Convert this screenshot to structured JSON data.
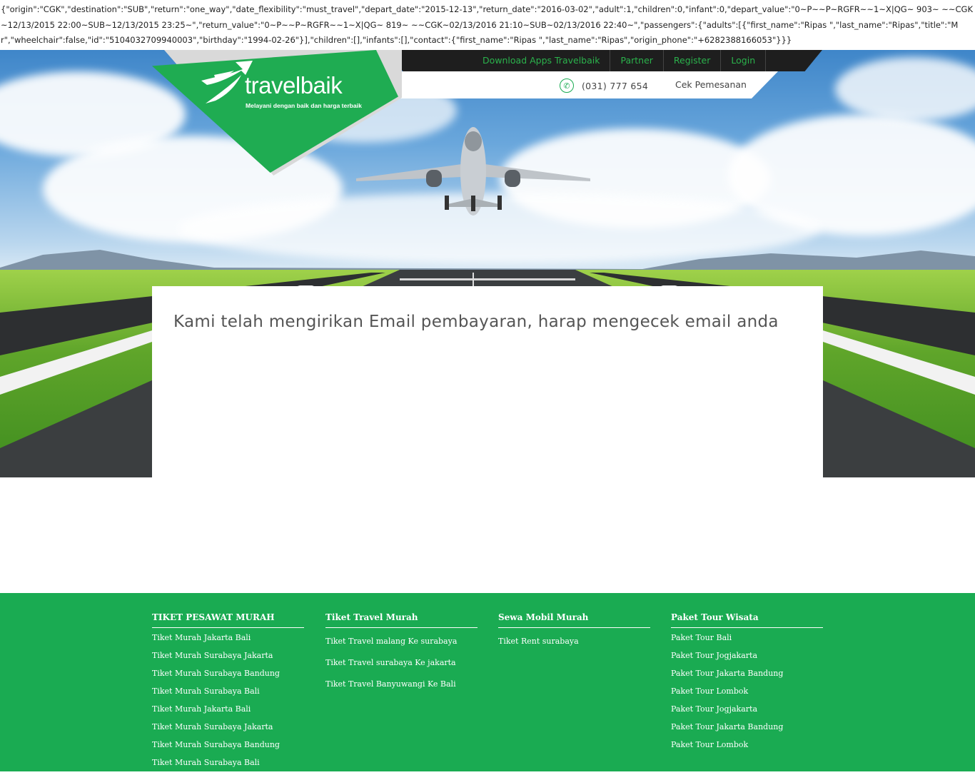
{
  "debug_dump": "{\"origin\":\"CGK\",\"destination\":\"SUB\",\"return\":\"one_way\",\"date_flexibility\":\"must_travel\",\"depart_date\":\"2015-12-13\",\"return_date\":\"2016-03-02\",\"adult\":1,\"children\":0,\"infant\":0,\"depart_value\":\"0~P~~P~RGFR~~1~X|QG~ 903~ ~~CGK~12/13/2015 22:00~SUB~12/13/2015 23:25~\",\"return_value\":\"0~P~~P~RGFR~~1~X|QG~ 819~ ~~CGK~02/13/2016 21:10~SUB~02/13/2016 22:40~\",\"passengers\":{\"adults\":[{\"first_name\":\"Ripas \",\"last_name\":\"Ripas\",\"title\":\"Mr\",\"wheelchair\":false,\"id\":\"5104032709940003\",\"birthday\":\"1994-02-26\"}],\"children\":[],\"infants\":[],\"contact\":{\"first_name\":\"Ripas \",\"last_name\":\"Ripas\",\"origin_phone\":\"+6282388166053\"}}}",
  "brand": {
    "name": "travelbaik",
    "tagline": "Melayani dengan baik dan harga terbaik",
    "green": "#1aab52"
  },
  "topnav": {
    "download": "Download Apps Travelbaik",
    "partner": "Partner",
    "register": "Register",
    "login": "Login"
  },
  "subnav": {
    "phone": "(031) 777 654",
    "cek": "Cek Pemesanan"
  },
  "main": {
    "message": "Kami telah mengirikan Email pembayaran, harap mengecek email anda"
  },
  "footer": {
    "columns": [
      {
        "title": "TIKET PESAWAT MURAH",
        "links": [
          "Tiket Murah Jakarta Bali",
          "Tiket Murah Surabaya Jakarta",
          "Tiket Murah Surabaya Bandung",
          "Tiket Murah Surabaya Bali",
          "Tiket Murah Jakarta Bali",
          "Tiket Murah Surabaya Jakarta",
          "Tiket Murah Surabaya Bandung",
          "Tiket Murah Surabaya Bali"
        ]
      },
      {
        "title": "Tiket Travel Murah",
        "links": [
          "Tiket Travel malang Ke surabaya",
          "Tiket Travel surabaya Ke jakarta",
          "Tiket Travel Banyuwangi Ke Bali"
        ]
      },
      {
        "title": "Sewa Mobil Murah",
        "links": [
          "Tiket Rent surabaya"
        ]
      },
      {
        "title": "Paket Tour Wisata",
        "links": [
          "Paket Tour Bali",
          "Paket Tour Jogjakarta",
          "Paket Tour Jakarta Bandung",
          "Paket Tour Lombok",
          "Paket Tour Jogjakarta",
          "Paket Tour Jakarta Bandung",
          "Paket Tour Lombok"
        ]
      }
    ]
  }
}
